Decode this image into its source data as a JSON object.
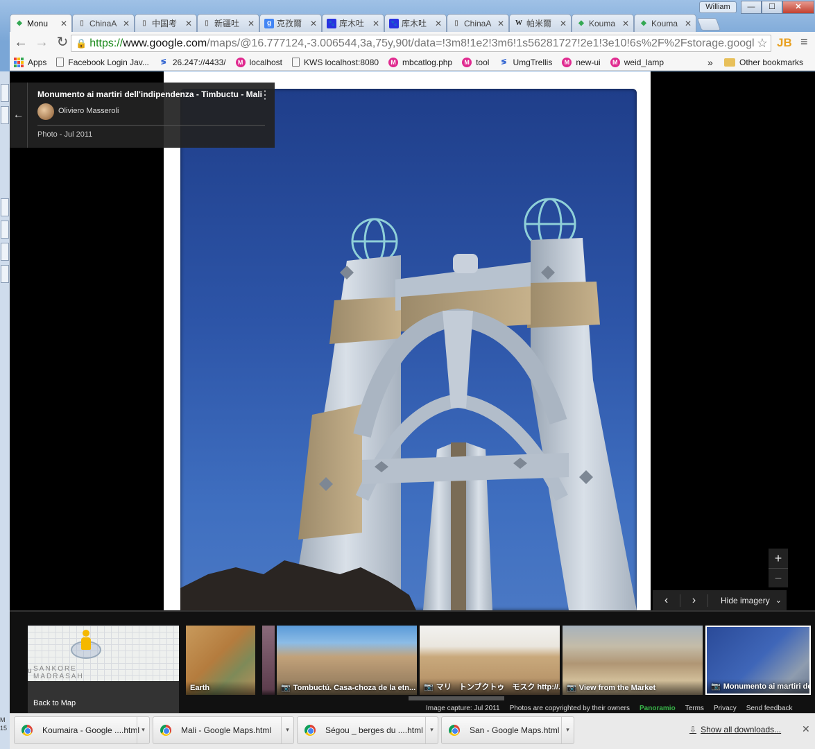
{
  "window": {
    "user": "William",
    "minimize": "—",
    "maximize": "☐",
    "close": "✕"
  },
  "tabs": [
    {
      "label": "Monu",
      "icon": "maps-icon",
      "active": true
    },
    {
      "label": "ChinaA",
      "icon": "page-icon"
    },
    {
      "label": "中国考",
      "icon": "page-icon"
    },
    {
      "label": "新疆吐",
      "icon": "page-icon"
    },
    {
      "label": "克孜爾",
      "icon": "google-icon"
    },
    {
      "label": "库木吐",
      "icon": "baidu-icon"
    },
    {
      "label": "库木吐",
      "icon": "baidu-icon"
    },
    {
      "label": "ChinaA",
      "icon": "page-icon"
    },
    {
      "label": "帕米爾",
      "icon": "wikipedia-icon"
    },
    {
      "label": "Kouma",
      "icon": "maps-icon"
    },
    {
      "label": "Kouma",
      "icon": "maps-icon"
    }
  ],
  "toolbar": {
    "url_scheme": "https://",
    "url_host": "www.google.com",
    "url_rest": "/maps/@16.777124,-3.006544,3a,75y,90t/data=!3m8!1e2!3m6!1s56281727!2e1!3e10!6s%2F%2Fstorage.googl",
    "extension_label": "JB"
  },
  "bookmarks": [
    {
      "label": "Apps",
      "icon": "apps-icon"
    },
    {
      "label": "Facebook Login Jav...",
      "icon": "page-icon"
    },
    {
      "label": "26.247://4433/",
      "icon": "gz-icon"
    },
    {
      "label": "localhost",
      "icon": "m-icon"
    },
    {
      "label": "KWS localhost:8080",
      "icon": "page-icon"
    },
    {
      "label": "mbcatlog.php",
      "icon": "m-icon"
    },
    {
      "label": "tool",
      "icon": "m-icon"
    },
    {
      "label": "UmgTrellis",
      "icon": "gz-icon"
    },
    {
      "label": "new-ui",
      "icon": "m-icon"
    },
    {
      "label": "weid_lamp",
      "icon": "m-icon"
    }
  ],
  "bookmarks_more": "»",
  "other_bookmarks": "Other bookmarks",
  "info_card": {
    "title": "Monumento ai martiri dell'indipendenza - Timbuctu - Mali",
    "author": "Oliviero Masseroli",
    "date": "Photo - Jul 2011"
  },
  "zoom": {
    "in": "+",
    "out": "−"
  },
  "photo_nav": {
    "prev": "‹",
    "next": "›",
    "hide_label": "Hide imagery"
  },
  "filmstrip": {
    "map_label_1": "SANKORE",
    "map_label_2": "MADRASAH",
    "map_edge_label": "u",
    "back_to_map": "Back to Map",
    "thumbs": [
      {
        "caption": "Earth",
        "camera": false
      },
      {
        "caption": "",
        "camera": false
      },
      {
        "caption": "Tombuctú. Casa-choza de la etn...",
        "camera": true
      },
      {
        "caption": "マリ　トンブクトゥ　モスク http://...",
        "camera": true
      },
      {
        "caption": "View from the Market",
        "camera": true
      },
      {
        "caption": "Monumento ai martiri dell'indi",
        "camera": true,
        "selected": true
      }
    ],
    "footer": {
      "capture": "Image capture: Jul 2011",
      "copyright": "Photos are copyrighted by their owners",
      "panoramio": "Panoramio",
      "terms": "Terms",
      "privacy": "Privacy",
      "feedback": "Send feedback"
    }
  },
  "downloads": [
    {
      "label": "Koumaira - Google ....html"
    },
    {
      "label": "Mali - Google Maps.html"
    },
    {
      "label": "Ségou _ berges du ....html"
    },
    {
      "label": "San - Google Maps.html"
    }
  ],
  "show_all_downloads": "Show all downloads...",
  "left_edge_text": "M\n15"
}
